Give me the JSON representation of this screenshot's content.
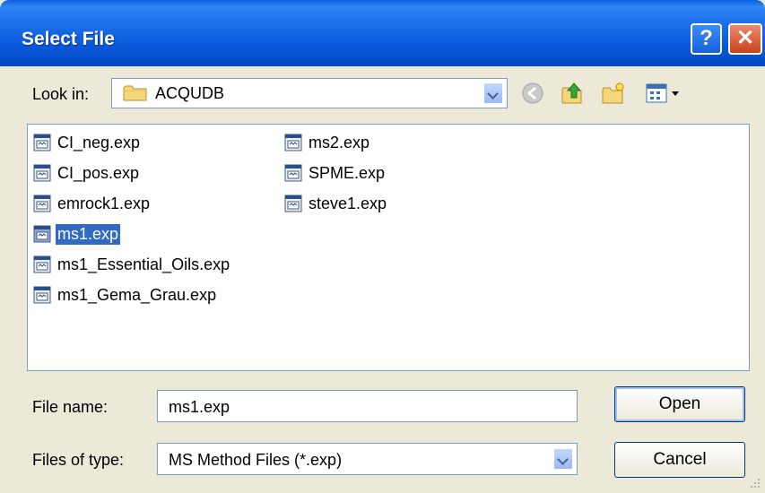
{
  "window": {
    "title": "Select File"
  },
  "titlebar_buttons": {
    "help": "?",
    "close": "✕"
  },
  "toolbar": {
    "look_in_label": "Look in:",
    "look_in_value": "ACQUDB",
    "icons": [
      "back-icon",
      "up-one-level-icon",
      "new-folder-icon",
      "view-menu-icon"
    ]
  },
  "files": [
    {
      "name": "CI_neg.exp",
      "selected": false
    },
    {
      "name": "CI_pos.exp",
      "selected": false
    },
    {
      "name": "emrock1.exp",
      "selected": false
    },
    {
      "name": "ms1.exp",
      "selected": true
    },
    {
      "name": "ms1_Essential_Oils.exp",
      "selected": false
    },
    {
      "name": "ms1_Gema_Grau.exp",
      "selected": false
    },
    {
      "name": "ms2.exp",
      "selected": false
    },
    {
      "name": "SPME.exp",
      "selected": false
    },
    {
      "name": "steve1.exp",
      "selected": false
    }
  ],
  "form": {
    "file_name_label": "File name:",
    "file_name_value": "ms1.exp",
    "file_type_label": "Files of type:",
    "file_type_value": "MS Method Files (*.exp)"
  },
  "buttons": {
    "open": "Open",
    "cancel": "Cancel"
  },
  "colors": {
    "titlebar": "#0758d8",
    "selection": "#316ac5",
    "dialog_bg": "#ece9d8"
  }
}
